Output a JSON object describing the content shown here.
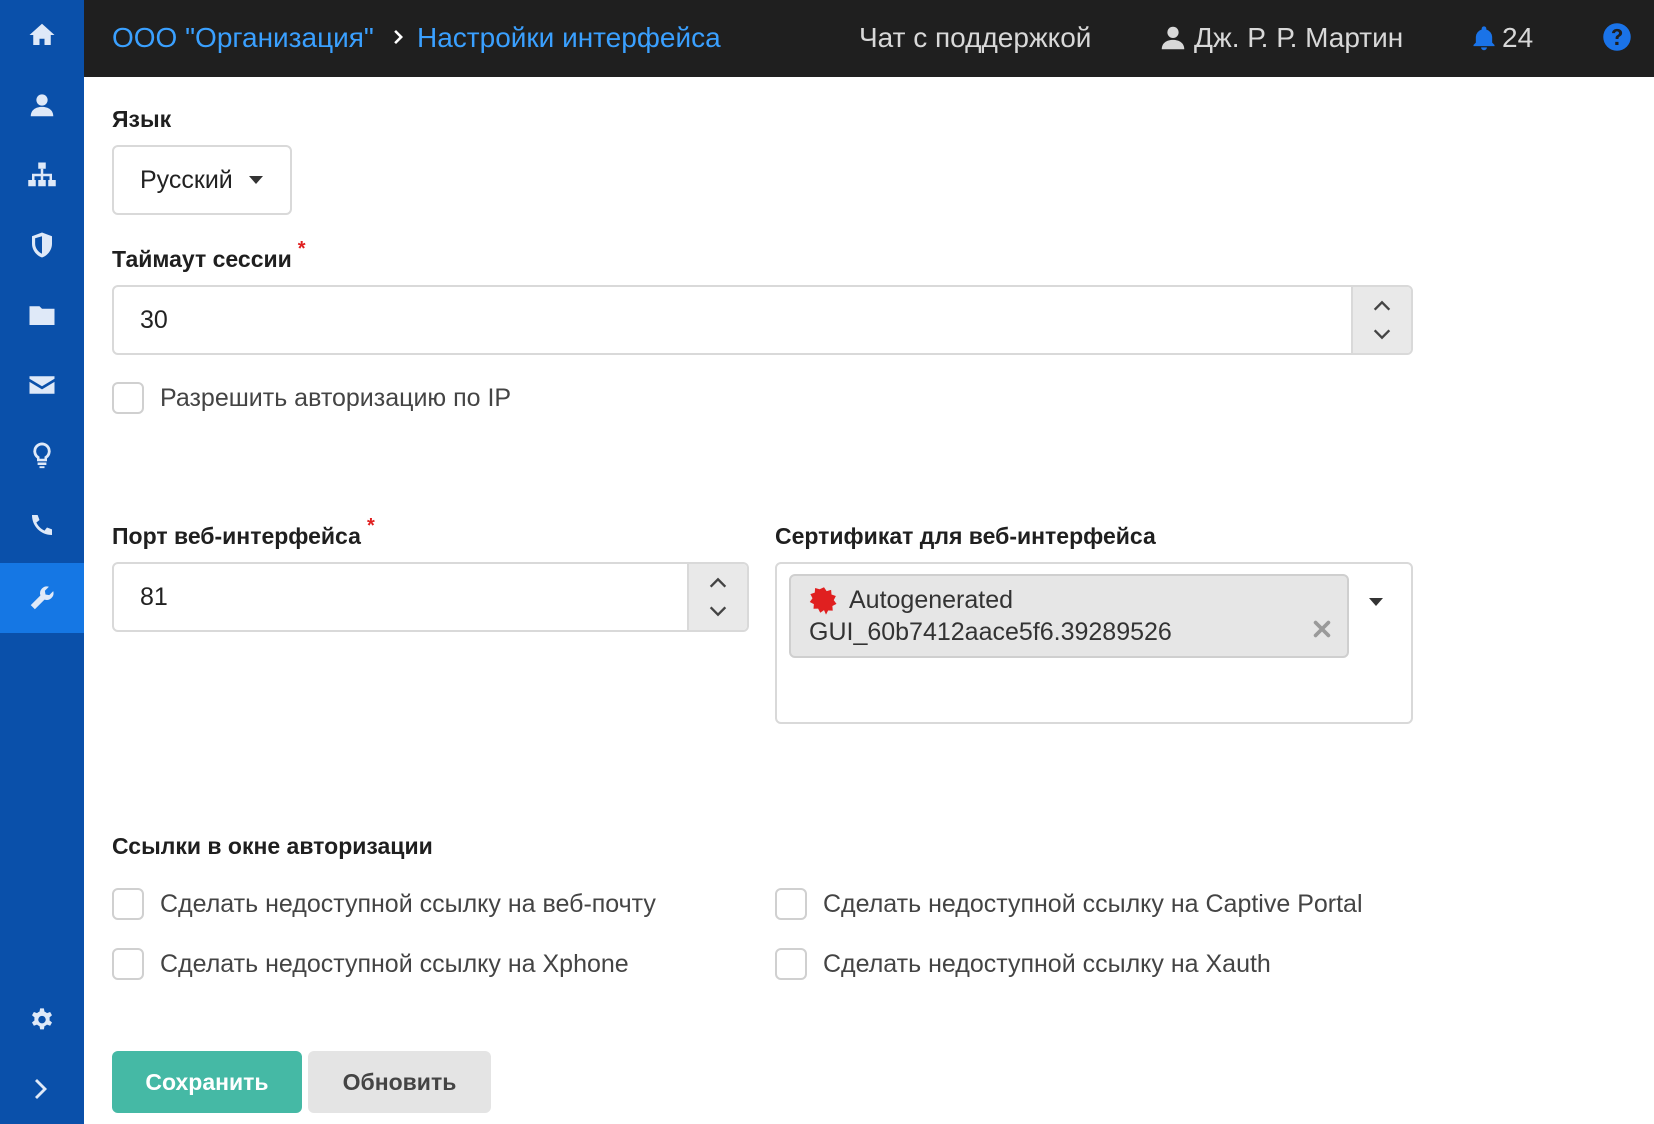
{
  "breadcrumb": {
    "org": "ООО \"Организация\"",
    "page": "Настройки интерфейса"
  },
  "topbar": {
    "support_chat": "Чат с поддержкой",
    "user_name": "Дж. Р. Р. Мартин",
    "notifications_count": "24"
  },
  "sidebar": {
    "items": [
      {
        "icon": "home-icon"
      },
      {
        "icon": "user-icon"
      },
      {
        "icon": "sitemap-icon"
      },
      {
        "icon": "shield-icon"
      },
      {
        "icon": "folder-icon"
      },
      {
        "icon": "envelope-icon"
      },
      {
        "icon": "lightbulb-icon"
      },
      {
        "icon": "phone-icon"
      },
      {
        "icon": "wrench-icon",
        "active": true
      }
    ],
    "bottom": [
      {
        "icon": "gear-icon"
      },
      {
        "icon": "chevron-right-icon"
      }
    ]
  },
  "form": {
    "language": {
      "label": "Язык",
      "value": "Русский"
    },
    "session_timeout": {
      "label": "Таймаут сессии",
      "value": "30",
      "required_mark": "*"
    },
    "allow_ip_auth": {
      "label": "Разрешить авторизацию по IP",
      "checked": false
    },
    "web_port": {
      "label": "Порт веб-интерфейса",
      "value": "81",
      "required_mark": "*"
    },
    "certificate": {
      "label": "Сертификат для веб-интерфейса",
      "selected_line1": "Autogenerated",
      "selected_line2": "GUI_60b7412aace5f6.39289526"
    },
    "auth_links": {
      "title": "Ссылки в окне авторизации",
      "options": [
        {
          "label": "Сделать недоступной ссылку на веб-почту",
          "checked": false
        },
        {
          "label": "Сделать недоступной ссылку на Captive Portal",
          "checked": false
        },
        {
          "label": "Сделать недоступной ссылку на Xphone",
          "checked": false
        },
        {
          "label": "Сделать недоступной ссылку на Xauth",
          "checked": false
        }
      ]
    }
  },
  "buttons": {
    "save": "Сохранить",
    "refresh": "Обновить"
  },
  "colors": {
    "sidebar": "#0a50aa",
    "sidebar_active": "#1577e4",
    "topbar": "#1f1f1f",
    "link": "#3aa0ff",
    "save_button": "#45b9a5",
    "required": "#e02020",
    "notification": "#1a73e8"
  }
}
